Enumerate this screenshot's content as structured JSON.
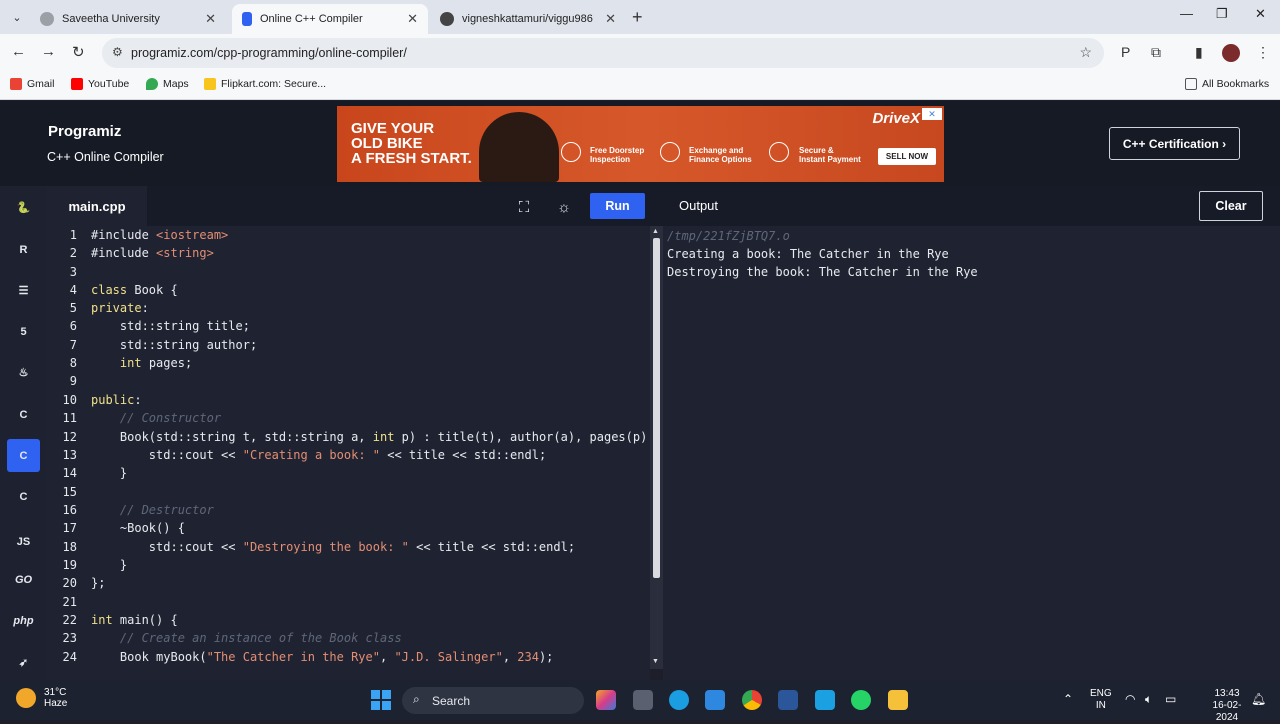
{
  "browser": {
    "tabs": [
      {
        "title": "Saveetha University",
        "active": false
      },
      {
        "title": "Online C++ Compiler",
        "active": true
      },
      {
        "title": "vigneshkattamuri/viggu986",
        "active": false
      }
    ],
    "url": "programiz.com/cpp-programming/online-compiler/",
    "bookmarks": [
      "Gmail",
      "YouTube",
      "Maps",
      "Flipkart.com: Secure..."
    ],
    "all_bookmarks": "All Bookmarks"
  },
  "header": {
    "logo": "Programiz",
    "subtitle": "C++ Online Compiler",
    "certification_button": "C++ Certification ›"
  },
  "ad": {
    "headline": [
      "GIVE YOUR",
      "OLD BIKE",
      "A FRESH START."
    ],
    "features": [
      [
        "Free Doorstep",
        "Inspection"
      ],
      [
        "Exchange and",
        "Finance Options"
      ],
      [
        "Secure &",
        "Instant Payment"
      ]
    ],
    "brand": "DriveX",
    "cta": "SELL NOW"
  },
  "languages": [
    "python-icon",
    "r-icon",
    "sql-icon",
    "html-icon",
    "java-icon",
    "c-icon",
    "cpp-icon",
    "csharp-icon",
    "JS",
    "GO",
    "php",
    "swift-icon"
  ],
  "editor": {
    "filename": "main.cpp",
    "run_label": "Run",
    "line_numbers": [
      "1",
      "2",
      "3",
      "4",
      "5",
      "6",
      "7",
      "8",
      "9",
      "10",
      "11",
      "12",
      "13",
      "14",
      "15",
      "16",
      "17",
      "18",
      "19",
      "20",
      "21",
      "22",
      "23",
      "24"
    ]
  },
  "output": {
    "title": "Output",
    "clear_label": "Clear",
    "lines": [
      "/tmp/221fZjBTQ7.o",
      "Creating a book: The Catcher in the Rye",
      "Destroying the book: The Catcher in the Rye"
    ]
  },
  "taskbar": {
    "temperature": "31°C",
    "condition": "Haze",
    "search_placeholder": "Search",
    "lang": "ENG",
    "region": "IN",
    "time": "13:43",
    "date": "16-02-2024"
  },
  "colors": {
    "accent": "#2f62f0",
    "editor_bg": "#1f2331",
    "keyword": "#f0e08a",
    "string": "#e48e73",
    "comment": "#5f6678"
  }
}
